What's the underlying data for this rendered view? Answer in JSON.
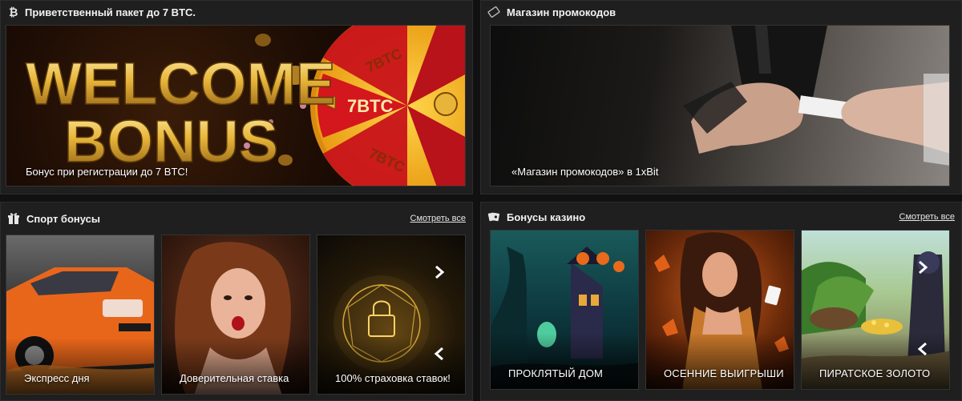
{
  "welcome": {
    "title": "Приветственный пакет до 7 BTC.",
    "banner_heading_line1": "WELCOME",
    "banner_heading_line2": "BONUS",
    "wheel_label": "7BTC",
    "caption": "Бонус при регистрации до 7 BTC!"
  },
  "promo_shop": {
    "title": "Магазин промокодов",
    "caption": "«Магазин промокодов» в 1xBit"
  },
  "sport_bonuses": {
    "title": "Спорт бонусы",
    "see_all": "Смотреть все",
    "cards": [
      {
        "label": "Экспресс дня"
      },
      {
        "label": "Доверительная ставка"
      },
      {
        "label": "100% страховка ставок!"
      }
    ]
  },
  "casino_bonuses": {
    "title": "Бонусы казино",
    "see_all": "Смотреть все",
    "cards": [
      {
        "label": "ПРОКЛЯТЫЙ ДОМ"
      },
      {
        "label": "ОСЕННИЕ ВЫИГРЫШИ"
      },
      {
        "label": "ПИРАТСКОЕ ЗОЛОТО"
      }
    ]
  },
  "icons": {
    "welcome": "bitcoin-icon",
    "promo": "ticket-icon",
    "sport": "gift-icon",
    "casino": "cards-icon",
    "next": "chevron-right-icon",
    "prev": "chevron-left-icon"
  },
  "colors": {
    "background": "#111111",
    "panel": "#1f1f1f",
    "gold": "#e8b53a",
    "wheel_red": "#c8131a"
  }
}
